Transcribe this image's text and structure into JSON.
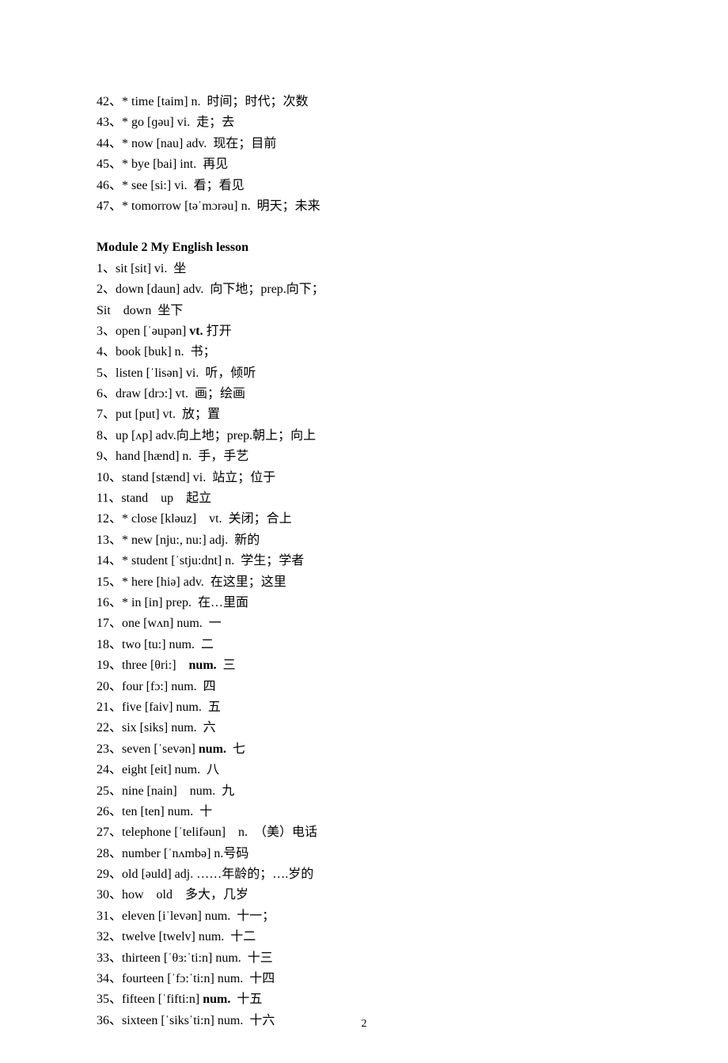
{
  "rows": [
    {
      "cls": "entry",
      "spans": [
        [
          "",
          "42、* time [taim] n.  时间；时代；次数"
        ]
      ]
    },
    {
      "cls": "entry",
      "spans": [
        [
          "",
          "43、* go [ɡəu] vi.  走；去"
        ]
      ]
    },
    {
      "cls": "entry",
      "spans": [
        [
          "",
          "44、* now [nau] adv.  现在；目前"
        ]
      ]
    },
    {
      "cls": "entry",
      "spans": [
        [
          "",
          "45、* bye [bai] int.  再见"
        ]
      ]
    },
    {
      "cls": "entry",
      "spans": [
        [
          "",
          "46、* see [si:] vi.  看；看见"
        ]
      ]
    },
    {
      "cls": "entry",
      "spans": [
        [
          "",
          "47、* tomorrow [təˈmɔrəu] n.  明天；未来"
        ]
      ]
    },
    {
      "cls": "module-title",
      "spans": [
        [
          "",
          "Module    2    My    English    lesson"
        ]
      ]
    },
    {
      "cls": "entry",
      "spans": [
        [
          "",
          "1、sit [sit] vi.  坐"
        ]
      ]
    },
    {
      "cls": "entry",
      "spans": [
        [
          "",
          "2、down [daun] adv.  向下地；prep.向下；"
        ]
      ]
    },
    {
      "cls": "entry",
      "spans": [
        [
          "",
          "Sit    down  坐下"
        ]
      ]
    },
    {
      "cls": "entry",
      "spans": [
        [
          "",
          "3、open [ˈəupən] "
        ],
        [
          "bold",
          "vt."
        ],
        [
          "",
          " 打开"
        ]
      ]
    },
    {
      "cls": "entry",
      "spans": [
        [
          "",
          "4、book [buk] n.  书；"
        ]
      ]
    },
    {
      "cls": "entry",
      "spans": [
        [
          "",
          "5、listen [ˈlisən] vi.  听，倾听"
        ]
      ]
    },
    {
      "cls": "entry",
      "spans": [
        [
          "",
          "6、draw [drɔ:] vt.  画；绘画"
        ]
      ]
    },
    {
      "cls": "entry",
      "spans": [
        [
          "",
          "7、put [put] vt.  放；置"
        ]
      ]
    },
    {
      "cls": "entry",
      "spans": [
        [
          "",
          "8、up [ʌp] adv.向上地；prep.朝上；向上"
        ]
      ]
    },
    {
      "cls": "entry",
      "spans": [
        [
          "",
          "9、hand [hænd] n.  手，手艺"
        ]
      ]
    },
    {
      "cls": "entry",
      "spans": [
        [
          "",
          "10、stand [stænd] vi.  站立；位于"
        ]
      ]
    },
    {
      "cls": "entry",
      "spans": [
        [
          "",
          "11、stand    up    起立"
        ]
      ]
    },
    {
      "cls": "entry",
      "spans": [
        [
          "",
          "12、* close [kləuz]    vt.  关闭；合上"
        ]
      ]
    },
    {
      "cls": "entry",
      "spans": [
        [
          "",
          "13、* new [nju:, nu:] adj.  新的"
        ]
      ]
    },
    {
      "cls": "entry",
      "spans": [
        [
          "",
          "14、* student [ˈstju:dnt] n.  学生；学者"
        ]
      ]
    },
    {
      "cls": "entry",
      "spans": [
        [
          "",
          "15、* here [hiə] adv.  在这里；这里"
        ]
      ]
    },
    {
      "cls": "entry",
      "spans": [
        [
          "",
          "16、* in [in] prep.  在…里面"
        ]
      ]
    },
    {
      "cls": "entry",
      "spans": [
        [
          "",
          "17、one [wʌn] num.  一"
        ]
      ]
    },
    {
      "cls": "entry",
      "spans": [
        [
          "",
          "18、two [tu:] num.  二"
        ]
      ]
    },
    {
      "cls": "entry",
      "spans": [
        [
          "",
          "19、three [θri:]    "
        ],
        [
          "bold",
          "num."
        ],
        [
          "",
          "  三"
        ]
      ]
    },
    {
      "cls": "entry",
      "spans": [
        [
          "",
          "20、four [fɔ:] num.  四"
        ]
      ]
    },
    {
      "cls": "entry",
      "spans": [
        [
          "",
          "21、five [faiv] num.  五"
        ]
      ]
    },
    {
      "cls": "entry",
      "spans": [
        [
          "",
          "22、six [siks] num.  六"
        ]
      ]
    },
    {
      "cls": "entry",
      "spans": [
        [
          "",
          "23、seven [ˈsevən] "
        ],
        [
          "bold",
          "num."
        ],
        [
          "",
          "  七"
        ]
      ]
    },
    {
      "cls": "entry",
      "spans": [
        [
          "",
          "24、eight [eit] num.  八"
        ]
      ]
    },
    {
      "cls": "entry",
      "spans": [
        [
          "",
          "25、nine [nain]    num.  九"
        ]
      ]
    },
    {
      "cls": "entry",
      "spans": [
        [
          "",
          "26、ten [ten] num.  十"
        ]
      ]
    },
    {
      "cls": "entry",
      "spans": [
        [
          "",
          "27、telephone [ˈtelifəun]    n.  （美）电话"
        ]
      ]
    },
    {
      "cls": "entry",
      "spans": [
        [
          "",
          "28、number [ˈnʌmbə] n.号码"
        ]
      ]
    },
    {
      "cls": "entry",
      "spans": [
        [
          "",
          "29、old [əuld] adj. ……年龄的；….岁的"
        ]
      ]
    },
    {
      "cls": "entry",
      "spans": [
        [
          "",
          "30、how    old    多大，几岁"
        ]
      ]
    },
    {
      "cls": "entry",
      "spans": [
        [
          "",
          "31、eleven [iˈlevən] num.  十一；"
        ]
      ]
    },
    {
      "cls": "entry",
      "spans": [
        [
          "",
          "32、twelve [twelv] num.  十二"
        ]
      ]
    },
    {
      "cls": "entry",
      "spans": [
        [
          "",
          "33、thirteen [ˈθɜ:ˈti:n] num.  十三"
        ]
      ]
    },
    {
      "cls": "entry",
      "spans": [
        [
          "",
          "34、fourteen [ˈfɔ:ˈti:n] num.  十四"
        ]
      ]
    },
    {
      "cls": "entry",
      "spans": [
        [
          "",
          "35、fifteen [ˈfifti:n] "
        ],
        [
          "bold",
          "num."
        ],
        [
          "",
          "  十五"
        ]
      ]
    },
    {
      "cls": "entry",
      "spans": [
        [
          "",
          "36、sixteen [ˈsiksˈti:n] num.  十六"
        ]
      ]
    }
  ],
  "pageNumber": "2"
}
